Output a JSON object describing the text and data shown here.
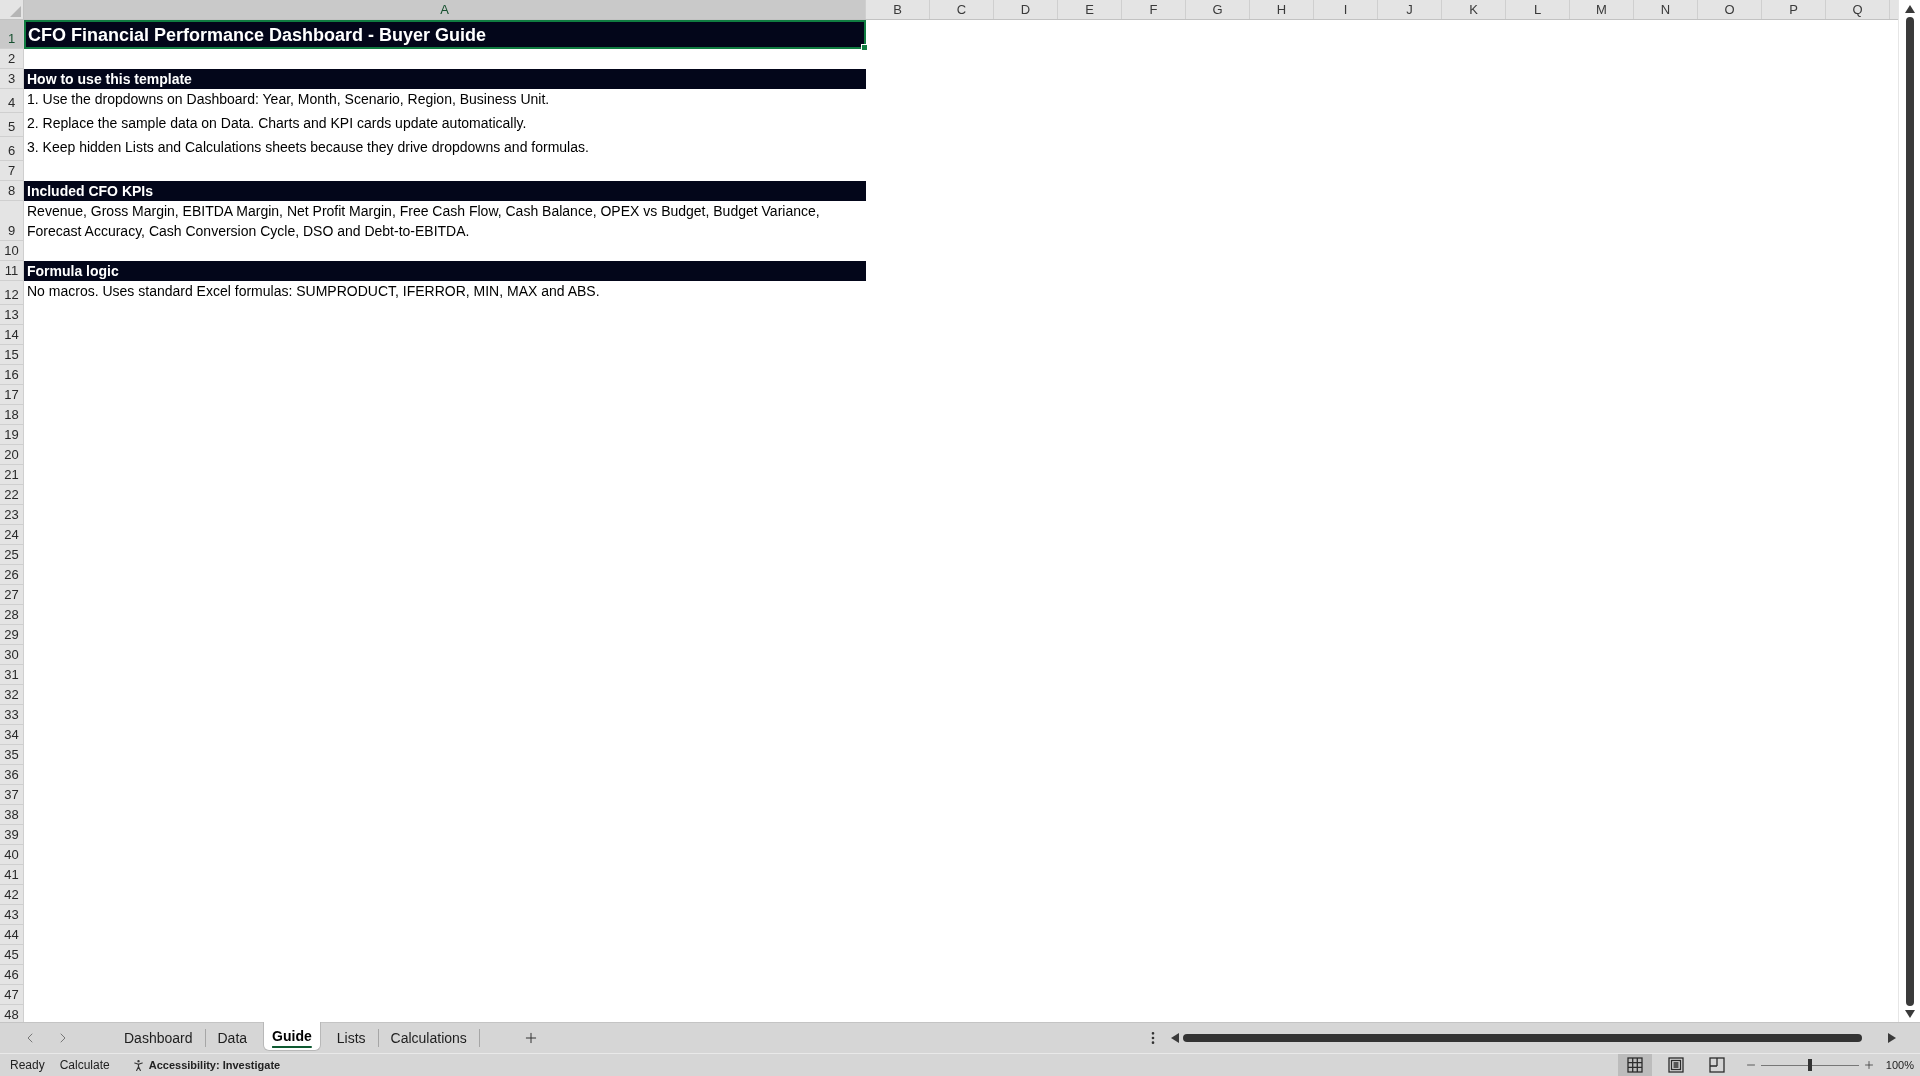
{
  "sheet": {
    "columns": [
      {
        "label": "A",
        "selected": true
      },
      {
        "label": "B",
        "selected": false
      },
      {
        "label": "C",
        "selected": false
      },
      {
        "label": "D",
        "selected": false
      },
      {
        "label": "E",
        "selected": false
      },
      {
        "label": "F",
        "selected": false
      },
      {
        "label": "G",
        "selected": false
      },
      {
        "label": "H",
        "selected": false
      },
      {
        "label": "I",
        "selected": false
      },
      {
        "label": "J",
        "selected": false
      },
      {
        "label": "K",
        "selected": false
      },
      {
        "label": "L",
        "selected": false
      },
      {
        "label": "M",
        "selected": false
      },
      {
        "label": "N",
        "selected": false
      },
      {
        "label": "O",
        "selected": false
      },
      {
        "label": "P",
        "selected": false
      },
      {
        "label": "Q",
        "selected": false
      }
    ],
    "rows": [
      {
        "number": "1",
        "selected": true,
        "kind": "title",
        "text": "CFO Financial Performance Dashboard - Buyer Guide"
      },
      {
        "number": "2",
        "selected": false,
        "kind": "blank"
      },
      {
        "number": "3",
        "selected": false,
        "kind": "header",
        "text": "How to use this template"
      },
      {
        "number": "4",
        "selected": false,
        "kind": "text",
        "text": "1. Use the dropdowns on Dashboard: Year, Month, Scenario, Region, Business Unit."
      },
      {
        "number": "5",
        "selected": false,
        "kind": "text",
        "text": "2. Replace the sample data on Data. Charts and KPI cards update automatically."
      },
      {
        "number": "6",
        "selected": false,
        "kind": "text",
        "text": "3. Keep hidden Lists and Calculations sheets because they drive dropdowns and formulas."
      },
      {
        "number": "7",
        "selected": false,
        "kind": "blank"
      },
      {
        "number": "8",
        "selected": false,
        "kind": "header",
        "text": "Included CFO KPIs"
      },
      {
        "number": "9",
        "selected": false,
        "kind": "text",
        "text": "Revenue, Gross Margin, EBITDA Margin, Net Profit Margin, Free Cash Flow, Cash Balance, OPEX vs Budget, Budget Variance, Forecast Accuracy, Cash Conversion Cycle, DSO and Debt-to-EBITDA."
      },
      {
        "number": "10",
        "selected": false,
        "kind": "blank"
      },
      {
        "number": "11",
        "selected": false,
        "kind": "header",
        "text": "Formula logic"
      },
      {
        "number": "12",
        "selected": false,
        "kind": "text",
        "text": "No macros. Uses standard Excel formulas: SUMPRODUCT, IFERROR, MIN, MAX and ABS."
      },
      {
        "number": "13",
        "selected": false,
        "kind": "blank"
      },
      {
        "number": "14",
        "selected": false,
        "kind": "blank"
      },
      {
        "number": "15",
        "selected": false,
        "kind": "blank"
      },
      {
        "number": "16",
        "selected": false,
        "kind": "blank"
      },
      {
        "number": "17",
        "selected": false,
        "kind": "blank"
      },
      {
        "number": "18",
        "selected": false,
        "kind": "blank"
      },
      {
        "number": "19",
        "selected": false,
        "kind": "blank"
      },
      {
        "number": "20",
        "selected": false,
        "kind": "blank"
      },
      {
        "number": "21",
        "selected": false,
        "kind": "blank"
      },
      {
        "number": "22",
        "selected": false,
        "kind": "blank"
      },
      {
        "number": "23",
        "selected": false,
        "kind": "blank"
      },
      {
        "number": "24",
        "selected": false,
        "kind": "blank"
      },
      {
        "number": "25",
        "selected": false,
        "kind": "blank"
      },
      {
        "number": "26",
        "selected": false,
        "kind": "blank"
      },
      {
        "number": "27",
        "selected": false,
        "kind": "blank"
      },
      {
        "number": "28",
        "selected": false,
        "kind": "blank"
      },
      {
        "number": "29",
        "selected": false,
        "kind": "blank"
      },
      {
        "number": "30",
        "selected": false,
        "kind": "blank"
      },
      {
        "number": "31",
        "selected": false,
        "kind": "blank"
      },
      {
        "number": "32",
        "selected": false,
        "kind": "blank"
      },
      {
        "number": "33",
        "selected": false,
        "kind": "blank"
      },
      {
        "number": "34",
        "selected": false,
        "kind": "blank"
      },
      {
        "number": "35",
        "selected": false,
        "kind": "blank"
      },
      {
        "number": "36",
        "selected": false,
        "kind": "blank"
      },
      {
        "number": "37",
        "selected": false,
        "kind": "blank"
      },
      {
        "number": "38",
        "selected": false,
        "kind": "blank"
      },
      {
        "number": "39",
        "selected": false,
        "kind": "blank"
      },
      {
        "number": "40",
        "selected": false,
        "kind": "blank"
      },
      {
        "number": "41",
        "selected": false,
        "kind": "blank"
      },
      {
        "number": "42",
        "selected": false,
        "kind": "blank"
      },
      {
        "number": "43",
        "selected": false,
        "kind": "blank"
      },
      {
        "number": "44",
        "selected": false,
        "kind": "blank"
      },
      {
        "number": "45",
        "selected": false,
        "kind": "blank"
      },
      {
        "number": "46",
        "selected": false,
        "kind": "blank"
      },
      {
        "number": "47",
        "selected": false,
        "kind": "blank"
      },
      {
        "number": "48",
        "selected": false,
        "kind": "blank"
      }
    ]
  },
  "sheet_tabs": [
    {
      "label": "Dashboard",
      "selected": false
    },
    {
      "label": "Data",
      "selected": false
    },
    {
      "label": "Guide",
      "selected": true
    },
    {
      "label": "Lists",
      "selected": false
    },
    {
      "label": "Calculations",
      "selected": false
    }
  ],
  "status_bar": {
    "mode": "Ready",
    "calculate": "Calculate",
    "accessibility": "Accessibility: Investigate",
    "views": [
      {
        "kind": "normal",
        "selected": true
      },
      {
        "kind": "page_layout",
        "selected": false
      },
      {
        "kind": "page_break_preview",
        "selected": false
      }
    ],
    "zoom": {
      "level": 0.5,
      "reading": "100%"
    }
  }
}
